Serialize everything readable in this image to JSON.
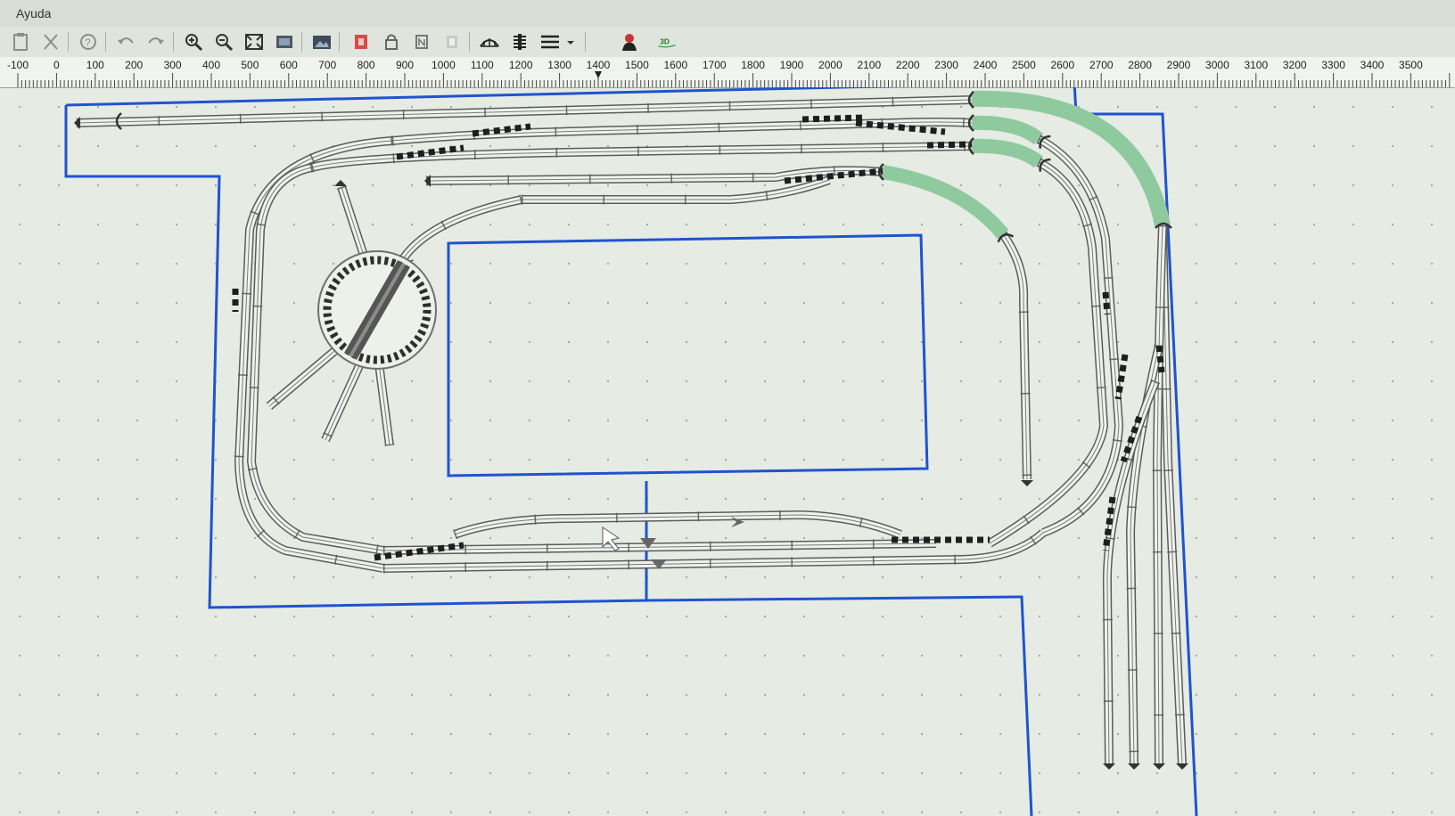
{
  "menubar": {
    "help_menu": "Ayuda"
  },
  "toolbar": {
    "buttons": [
      {
        "icon": "paste-icon"
      },
      {
        "icon": "cut-icon"
      },
      {
        "icon": "help-icon"
      },
      {
        "icon": "undo-icon"
      },
      {
        "icon": "redo-icon"
      },
      {
        "icon": "zoom-in-icon"
      },
      {
        "icon": "zoom-out-icon"
      },
      {
        "icon": "zoom-fit-icon"
      },
      {
        "icon": "zoom-window-icon"
      },
      {
        "icon": "background-image-icon"
      },
      {
        "icon": "layer-red-icon"
      },
      {
        "icon": "layer-lock-icon"
      },
      {
        "icon": "layer-n-icon"
      },
      {
        "icon": "layer-gray-icon"
      },
      {
        "icon": "track-bridge-icon"
      },
      {
        "icon": "track-cross-icon"
      },
      {
        "icon": "track-parallel-icon"
      },
      {
        "icon": "person-icon"
      }
    ],
    "view_3d_label": "3D"
  },
  "ruler": {
    "labels": [
      "-100",
      "0",
      "100",
      "200",
      "300",
      "400",
      "500",
      "600",
      "700",
      "800",
      "900",
      "1000",
      "1100",
      "1200",
      "1300",
      "1400",
      "1500",
      "1600",
      "1700",
      "1800",
      "1900",
      "2000",
      "2100",
      "2200",
      "2300",
      "2400",
      "2500",
      "2600",
      "2700",
      "2800",
      "2900",
      "3000",
      "3100",
      "3200",
      "3300",
      "3400",
      "3500"
    ],
    "cursor_mark": "1400"
  },
  "colors": {
    "board_outline": "#1f53d0",
    "track_rail": "#5c5c5c",
    "track_sleeper_fill": "#eef2ec",
    "selected_track": "#8fca9e",
    "turntable": "#3a3a3a",
    "canvas_bg": "#e6ebe4",
    "grid_dot": "#9aa598"
  }
}
